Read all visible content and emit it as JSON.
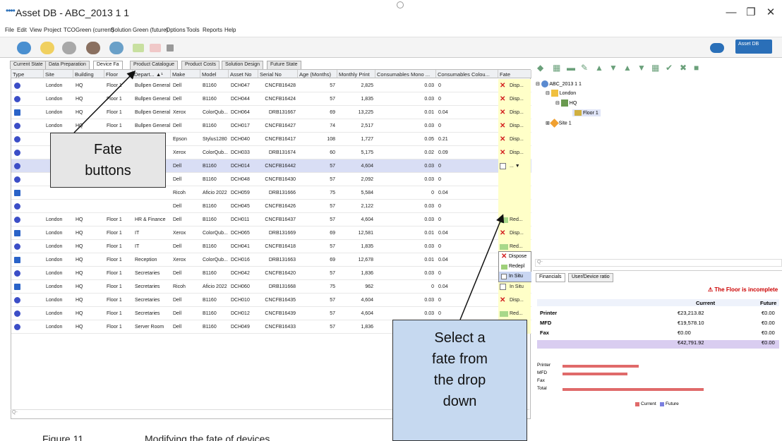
{
  "window": {
    "title": "Asset DB - ABC_2013 1 1",
    "minimize": "—",
    "restore": "❐",
    "close": "✕"
  },
  "menu": [
    "File",
    "Edit",
    "View",
    "Project",
    "TCO",
    "Green (current)",
    "Solution",
    "Green (future)",
    "Options",
    "Tools",
    "Reports",
    "Help"
  ],
  "toolbar": {
    "assetdb_label": "Asset DB"
  },
  "tabs": [
    "Current State",
    "Data Preparation",
    "Device Fa",
    "Product Catalogue",
    "Product Costs",
    "Solution Design",
    "Future State"
  ],
  "columns": [
    "Type",
    "Site",
    "Building",
    "Floor",
    "Depart... ▲¹",
    "Make",
    "Model",
    "Asset No",
    "Serial No",
    "Age (Months)",
    "Monthly Print",
    "Consumables Mono ...",
    "Consumables Colou...",
    "Fate"
  ],
  "rows": [
    {
      "type": "printer",
      "site": "London",
      "building": "HQ",
      "floor": "Floor 1",
      "dept": "Bullpen General",
      "make": "Dell",
      "model": "B1160",
      "asset": "DCH047",
      "serial": "CNCFB16428",
      "age": "57",
      "print": "2,825",
      "mono": "0.03",
      "colour": "0",
      "fate": "Disp...",
      "fate_icon": "dispose"
    },
    {
      "type": "printer",
      "site": "London",
      "building": "HQ",
      "floor": "Floor 1",
      "dept": "Bullpen General",
      "make": "Dell",
      "model": "B1160",
      "asset": "DCH044",
      "serial": "CNCFB16424",
      "age": "57",
      "print": "1,835",
      "mono": "0.03",
      "colour": "0",
      "fate": "Disp...",
      "fate_icon": "dispose"
    },
    {
      "type": "mfd",
      "site": "London",
      "building": "HQ",
      "floor": "Floor 1",
      "dept": "Bullpen General",
      "make": "Xerox",
      "model": "ColorQub...",
      "asset": "DCH064",
      "serial": "DRB131667",
      "age": "69",
      "print": "13,225",
      "mono": "0.01",
      "colour": "0.04",
      "fate": "Disp...",
      "fate_icon": "dispose"
    },
    {
      "type": "printer",
      "site": "London",
      "building": "HQ",
      "floor": "Floor 1",
      "dept": "Bullpen General",
      "make": "Dell",
      "model": "B1160",
      "asset": "DCH017",
      "serial": "CNCFB16427",
      "age": "74",
      "print": "2,517",
      "mono": "0.03",
      "colour": "0",
      "fate": "Disp...",
      "fate_icon": "dispose"
    },
    {
      "type": "printer",
      "site": "",
      "building": "",
      "floor": "",
      "dept": "",
      "make": "Epson",
      "model": "Stylus1280",
      "asset": "DCH040",
      "serial": "CNCFB16417",
      "age": "108",
      "print": "1,727",
      "mono": "0.05",
      "colour": "0.21",
      "fate": "Disp...",
      "fate_icon": "dispose"
    },
    {
      "type": "printer",
      "site": "",
      "building": "",
      "floor": "",
      "dept": "",
      "make": "Xerox",
      "model": "ColorQub...",
      "asset": "DCH033",
      "serial": "DRB131674",
      "age": "60",
      "print": "5,175",
      "mono": "0.02",
      "colour": "0.09",
      "fate": "Disp...",
      "fate_icon": "dispose"
    },
    {
      "type": "printer",
      "site": "",
      "building": "",
      "floor": "",
      "dept": "",
      "make": "Dell",
      "model": "B1160",
      "asset": "DCH014",
      "serial": "CNCFB16442",
      "age": "57",
      "print": "4,604",
      "mono": "0.03",
      "colour": "0",
      "fate": "... ▼",
      "fate_icon": "none"
    },
    {
      "type": "printer",
      "site": "",
      "building": "",
      "floor": "",
      "dept": "",
      "make": "Dell",
      "model": "B1160",
      "asset": "DCH048",
      "serial": "CNCFB16430",
      "age": "57",
      "print": "2,092",
      "mono": "0.03",
      "colour": "0",
      "fate": "",
      "fate_icon": "none"
    },
    {
      "type": "mfd",
      "site": "",
      "building": "",
      "floor": "",
      "dept": "",
      "make": "Ricoh",
      "model": "Aficio 2022",
      "asset": "DCH059",
      "serial": "DRB131666",
      "age": "75",
      "print": "5,584",
      "mono": "0",
      "colour": "0.04",
      "fate": "",
      "fate_icon": "none"
    },
    {
      "type": "printer",
      "site": "",
      "building": "",
      "floor": "",
      "dept": "",
      "make": "Dell",
      "model": "B1160",
      "asset": "DCH045",
      "serial": "CNCFB16426",
      "age": "57",
      "print": "2,122",
      "mono": "0.03",
      "colour": "0",
      "fate": "",
      "fate_icon": "none"
    },
    {
      "type": "printer",
      "site": "London",
      "building": "HQ",
      "floor": "Floor 1",
      "dept": "HR & Finance",
      "make": "Dell",
      "model": "B1160",
      "asset": "DCH011",
      "serial": "CNCFB16437",
      "age": "57",
      "print": "4,604",
      "mono": "0.03",
      "colour": "0",
      "fate": "Red...",
      "fate_icon": "redeploy"
    },
    {
      "type": "mfd",
      "site": "London",
      "building": "HQ",
      "floor": "Floor 1",
      "dept": "IT",
      "make": "Xerox",
      "model": "ColorQub...",
      "asset": "DCH065",
      "serial": "DRB131669",
      "age": "69",
      "print": "12,581",
      "mono": "0.01",
      "colour": "0.04",
      "fate": "Disp...",
      "fate_icon": "dispose"
    },
    {
      "type": "printer",
      "site": "London",
      "building": "HQ",
      "floor": "Floor 1",
      "dept": "IT",
      "make": "Dell",
      "model": "B1160",
      "asset": "DCH041",
      "serial": "CNCFB16418",
      "age": "57",
      "print": "1,835",
      "mono": "0.03",
      "colour": "0",
      "fate": "Red...",
      "fate_icon": "redeploy"
    },
    {
      "type": "mfd",
      "site": "London",
      "building": "HQ",
      "floor": "Floor 1",
      "dept": "Reception",
      "make": "Xerox",
      "model": "ColorQub...",
      "asset": "DCH016",
      "serial": "DRB131663",
      "age": "69",
      "print": "12,678",
      "mono": "0.01",
      "colour": "0.04",
      "fate": "Disp...",
      "fate_icon": "dispose"
    },
    {
      "type": "printer",
      "site": "London",
      "building": "HQ",
      "floor": "Floor 1",
      "dept": "Secretaries",
      "make": "Dell",
      "model": "B1160",
      "asset": "DCH042",
      "serial": "CNCFB16420",
      "age": "57",
      "print": "1,836",
      "mono": "0.03",
      "colour": "0",
      "fate": "In Situ",
      "fate_icon": "insitu"
    },
    {
      "type": "mfd",
      "site": "London",
      "building": "HQ",
      "floor": "Floor 1",
      "dept": "Secretaries",
      "make": "Ricoh",
      "model": "Aficio 2022",
      "asset": "DCH060",
      "serial": "DRB131668",
      "age": "75",
      "print": "962",
      "mono": "0",
      "colour": "0.04",
      "fate": "In Situ",
      "fate_icon": "insitu"
    },
    {
      "type": "printer",
      "site": "London",
      "building": "HQ",
      "floor": "Floor 1",
      "dept": "Secretaries",
      "make": "Dell",
      "model": "B1160",
      "asset": "DCH010",
      "serial": "CNCFB16435",
      "age": "57",
      "print": "4,604",
      "mono": "0.03",
      "colour": "0",
      "fate": "Disp...",
      "fate_icon": "dispose"
    },
    {
      "type": "printer",
      "site": "London",
      "building": "HQ",
      "floor": "Floor 1",
      "dept": "Secretaries",
      "make": "Dell",
      "model": "B1160",
      "asset": "DCH012",
      "serial": "CNCFB16439",
      "age": "57",
      "print": "4,604",
      "mono": "0.03",
      "colour": "0",
      "fate": "Red...",
      "fate_icon": "redeploy"
    },
    {
      "type": "printer",
      "site": "London",
      "building": "HQ",
      "floor": "Floor 1",
      "dept": "Server Room",
      "make": "Dell",
      "model": "B1160",
      "asset": "DCH049",
      "serial": "CNCFB16433",
      "age": "57",
      "print": "1,836",
      "mono": "",
      "colour": "",
      "fate": "",
      "fate_icon": "none"
    }
  ],
  "dropdown": {
    "dispose": "Dispose",
    "redeploy": "Redepl",
    "insitu": "In Situ"
  },
  "tree": {
    "root": "ABC_2013 1 1",
    "london": "London",
    "hq": "HQ",
    "floor": "Floor 1",
    "site1": "Site 1"
  },
  "search_placeholder": "Q-",
  "financials": {
    "tab1": "Financials",
    "tab2": "User/Device ratio",
    "warning": "The Floor is incomplete",
    "col_current": "Current",
    "col_future": "Future",
    "rows": [
      {
        "label": "Printer",
        "current": "€23,213.82",
        "future": "€0.00"
      },
      {
        "label": "MFD",
        "current": "€19,578.10",
        "future": "€0.00"
      },
      {
        "label": "Fax",
        "current": "€0.00",
        "future": "€0.00"
      },
      {
        "label": "",
        "current": "€42,791.92",
        "future": "€0.00"
      }
    ],
    "legend_labels": [
      "Printer",
      "MFD",
      "Fax",
      "Total"
    ],
    "bar_values": {
      "printer": 23213.82,
      "mfd": 19578.1,
      "fax": 0,
      "total": 42791.92
    },
    "legend_current": "Current",
    "legend_future": "Future"
  },
  "callouts": {
    "fate": [
      "Fate",
      "buttons"
    ],
    "select": [
      "Select a",
      "fate from",
      "the drop",
      "down"
    ]
  },
  "caption": {
    "number": "Figure 11",
    "text": "Modifying the fate of devices"
  },
  "colors": {
    "accent": "#2a6fb8",
    "dispose": "#d32020",
    "redeploy": "#6aa84f",
    "fate_bg": "#ffffc8",
    "bar_current": "#e06a6a",
    "bar_future": "#7b7fe0"
  }
}
